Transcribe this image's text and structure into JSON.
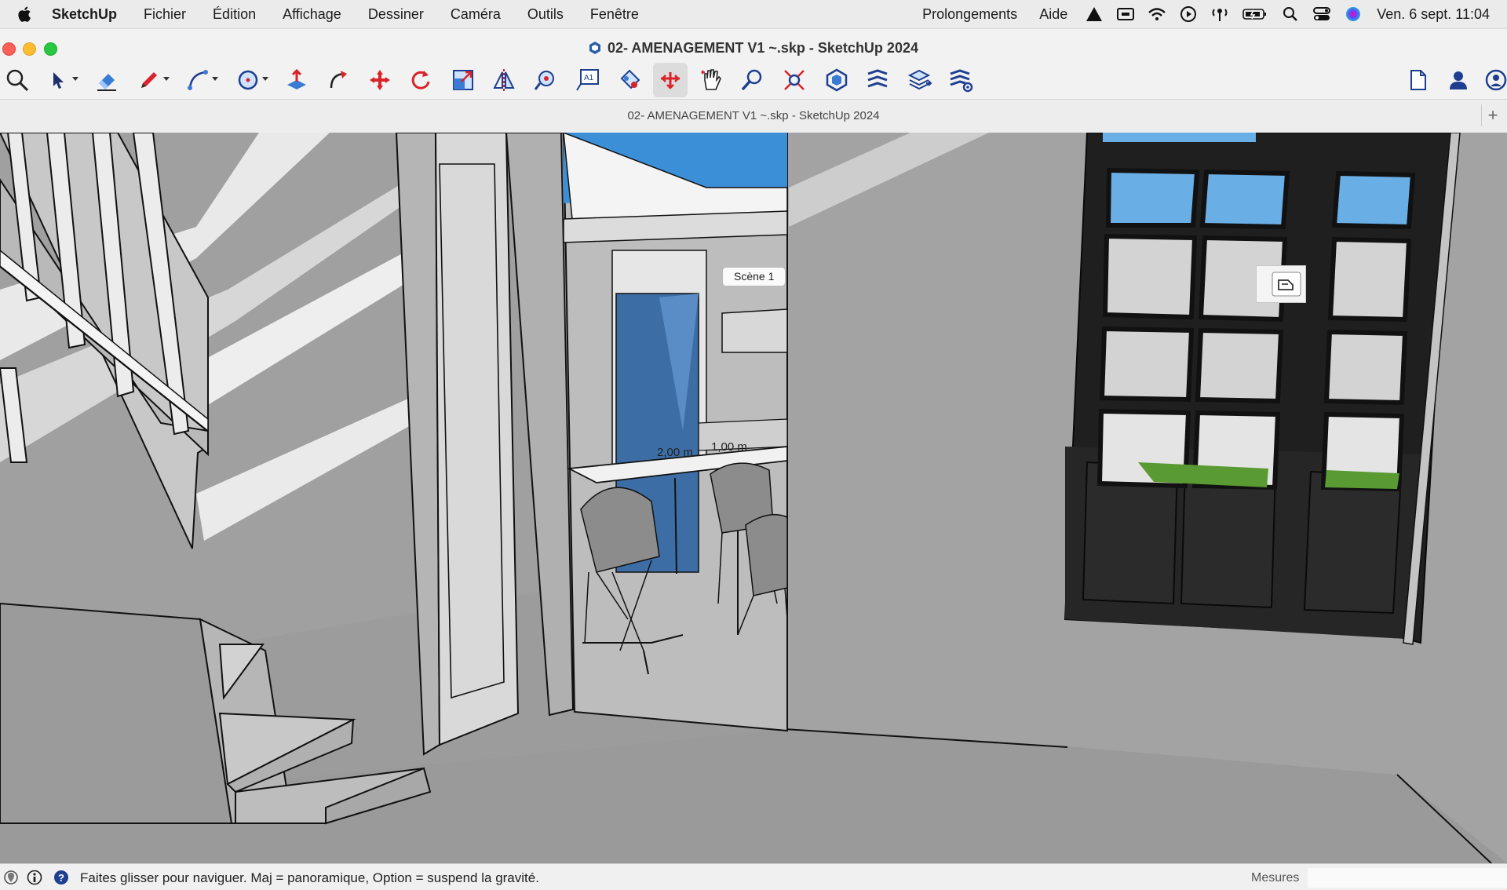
{
  "menubar": {
    "app_name": "SketchUp",
    "items": [
      "Fichier",
      "Édition",
      "Affichage",
      "Dessiner",
      "Caméra",
      "Outils",
      "Fenêtre"
    ],
    "right_items": [
      "Prolongements",
      "Aide"
    ],
    "clock": "Ven. 6 sept. 11:04",
    "status_icons": [
      "warning-icon",
      "screen-mirror-icon",
      "wifi-icon",
      "play-icon",
      "network-icon",
      "battery-icon",
      "search-icon",
      "control-center-icon",
      "siri-icon"
    ]
  },
  "window": {
    "title": "02- AMENAGEMENT V1 ~.skp - SketchUp 2024"
  },
  "toolbar": {
    "tools": [
      "search",
      "select",
      "eraser",
      "line",
      "arc",
      "circle",
      "push-pull",
      "follow-me",
      "move",
      "rotate",
      "scale",
      "flip",
      "tape-measure",
      "text",
      "paint-bucket",
      "walk",
      "look-around",
      "zoom",
      "zoom-extents",
      "solid-tools",
      "sandbox",
      "layers",
      "settings"
    ],
    "active_tool": "walk",
    "right_tools": [
      "new-document",
      "account",
      "profile"
    ]
  },
  "tab": {
    "title": "02- AMENAGEMENT V1 ~.skp - SketchUp 2024",
    "add": "+"
  },
  "viewport": {
    "scene_label": "Scène 1",
    "dimensions": [
      "2,00 m",
      "1,00 m"
    ]
  },
  "statusbar": {
    "hint": "Faites glisser pour naviguer. Maj = panoramique, Option =  suspend la gravité.",
    "measure_label": "Mesures",
    "measure_value": ""
  }
}
